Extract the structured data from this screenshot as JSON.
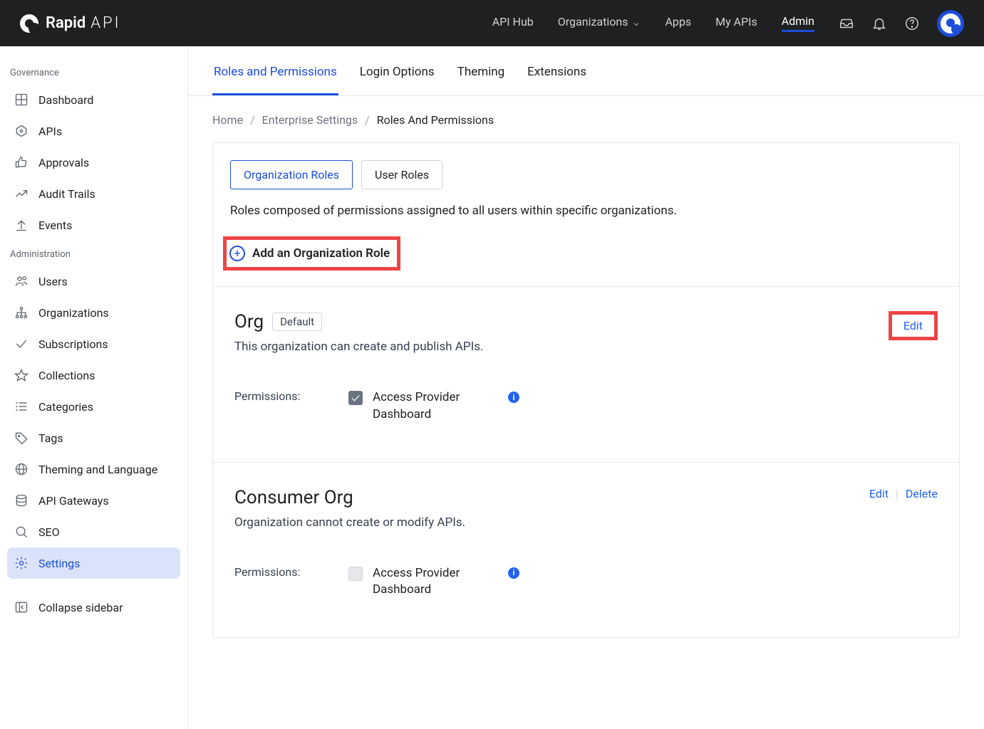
{
  "brand": {
    "name": "Rapid",
    "suffix": "API"
  },
  "nav": {
    "links": [
      {
        "label": "API Hub"
      },
      {
        "label": "Organizations",
        "dropdown": true
      },
      {
        "label": "Apps"
      },
      {
        "label": "My APIs"
      },
      {
        "label": "Admin",
        "active": true
      }
    ]
  },
  "sidebar": {
    "sections": [
      {
        "title": "Governance",
        "items": [
          {
            "label": "Dashboard",
            "icon": "grid"
          },
          {
            "label": "APIs",
            "icon": "hex"
          },
          {
            "label": "Approvals",
            "icon": "thumb"
          },
          {
            "label": "Audit Trails",
            "icon": "chart"
          },
          {
            "label": "Events",
            "icon": "upload"
          }
        ]
      },
      {
        "title": "Administration",
        "items": [
          {
            "label": "Users",
            "icon": "users"
          },
          {
            "label": "Organizations",
            "icon": "tree"
          },
          {
            "label": "Subscriptions",
            "icon": "check"
          },
          {
            "label": "Collections",
            "icon": "star"
          },
          {
            "label": "Categories",
            "icon": "list"
          },
          {
            "label": "Tags",
            "icon": "tag"
          },
          {
            "label": "Theming and Language",
            "icon": "globe"
          },
          {
            "label": "API Gateways",
            "icon": "stack"
          },
          {
            "label": "SEO",
            "icon": "search"
          },
          {
            "label": "Settings",
            "icon": "gear",
            "active": true
          }
        ]
      }
    ],
    "collapse": "Collapse sidebar"
  },
  "tabs": [
    {
      "label": "Roles and Permissions",
      "active": true
    },
    {
      "label": "Login Options"
    },
    {
      "label": "Theming"
    },
    {
      "label": "Extensions"
    }
  ],
  "breadcrumbs": {
    "items": [
      "Home",
      "Enterprise Settings",
      "Roles And Permissions"
    ]
  },
  "roleTabs": [
    {
      "label": "Organization Roles",
      "active": true
    },
    {
      "label": "User Roles"
    }
  ],
  "roleTabDesc": "Roles composed of permissions assigned to all users within specific organizations.",
  "addRole": "Add an Organization Role",
  "permissionsLabel": "Permissions:",
  "defaultBadge": "Default",
  "actions": {
    "edit": "Edit",
    "delete": "Delete"
  },
  "roles": [
    {
      "name": "Org",
      "default": true,
      "desc": "This organization can create and publish APIs.",
      "highlightEdit": true,
      "perms": [
        {
          "label": "Access Provider Dashboard",
          "checked": true
        }
      ]
    },
    {
      "name": "Consumer Org",
      "default": false,
      "desc": "Organization cannot create or modify APIs.",
      "showDelete": true,
      "perms": [
        {
          "label": "Access Provider Dashboard",
          "checked": false
        }
      ]
    }
  ]
}
